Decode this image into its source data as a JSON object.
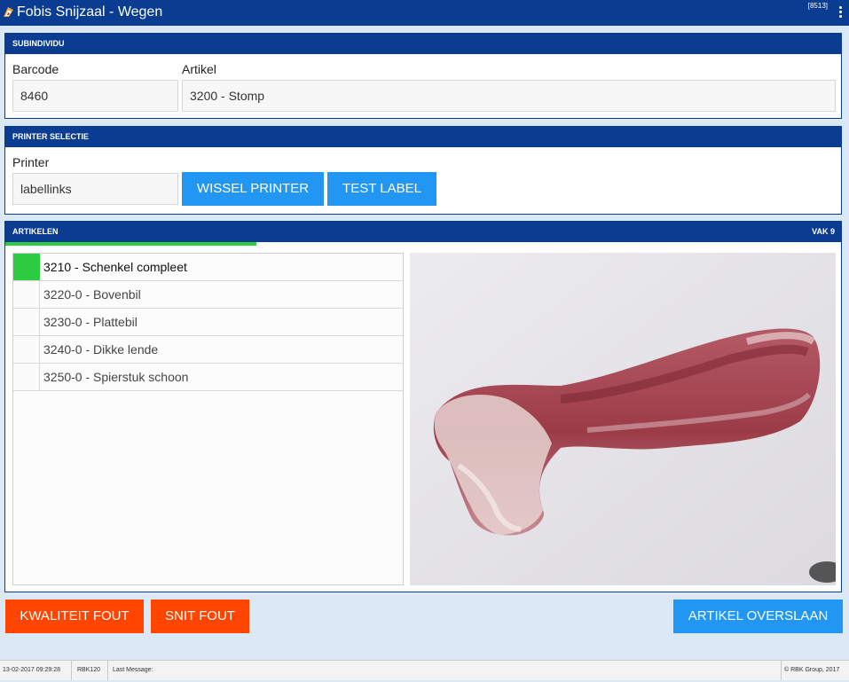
{
  "window": {
    "title": "Fobis Snijzaal - Wegen",
    "code": "[8513]",
    "app_icon": "fobis-logo-icon",
    "menu_icon": "kebab-menu-icon"
  },
  "subindividu": {
    "header": "SUBINDIVIDU",
    "barcode_label": "Barcode",
    "barcode_value": "8460",
    "artikel_label": "Artikel",
    "artikel_value": "3200 - Stomp"
  },
  "printer": {
    "header": "PRINTER SELECTIE",
    "printer_label": "Printer",
    "printer_value": "labellinks",
    "wissel_button": "WISSEL PRINTER",
    "test_button": "TEST LABEL"
  },
  "artikelen": {
    "header": "ARTIKELEN",
    "vak": "VAK 9",
    "progress_fraction": 0.3,
    "items": [
      {
        "label": "3210 - Schenkel compleet",
        "selected": true
      },
      {
        "label": "3220-0 - Bovenbil",
        "selected": false
      },
      {
        "label": "3230-0 - Plattebil",
        "selected": false
      },
      {
        "label": "3240-0 - Dikke lende",
        "selected": false
      },
      {
        "label": "3250-0 - Spierstuk schoon",
        "selected": false
      }
    ]
  },
  "actions": {
    "kwaliteit_fout": "KWALITEIT FOUT",
    "snit_fout": "SNIT FOUT",
    "artikel_overslaan": "ARTIKEL OVERSLAAN"
  },
  "statusbar": {
    "datetime": "13-02-2017 09:29:28",
    "user": "RBK120",
    "last_message_label": "Last Message:",
    "copyright": "© RBK Group, 2017"
  },
  "colors": {
    "header_blue": "#0a3d91",
    "button_blue": "#2196f3",
    "button_red": "#ff4500",
    "selected_green": "#2ecc40",
    "background": "#dbe9f7"
  }
}
